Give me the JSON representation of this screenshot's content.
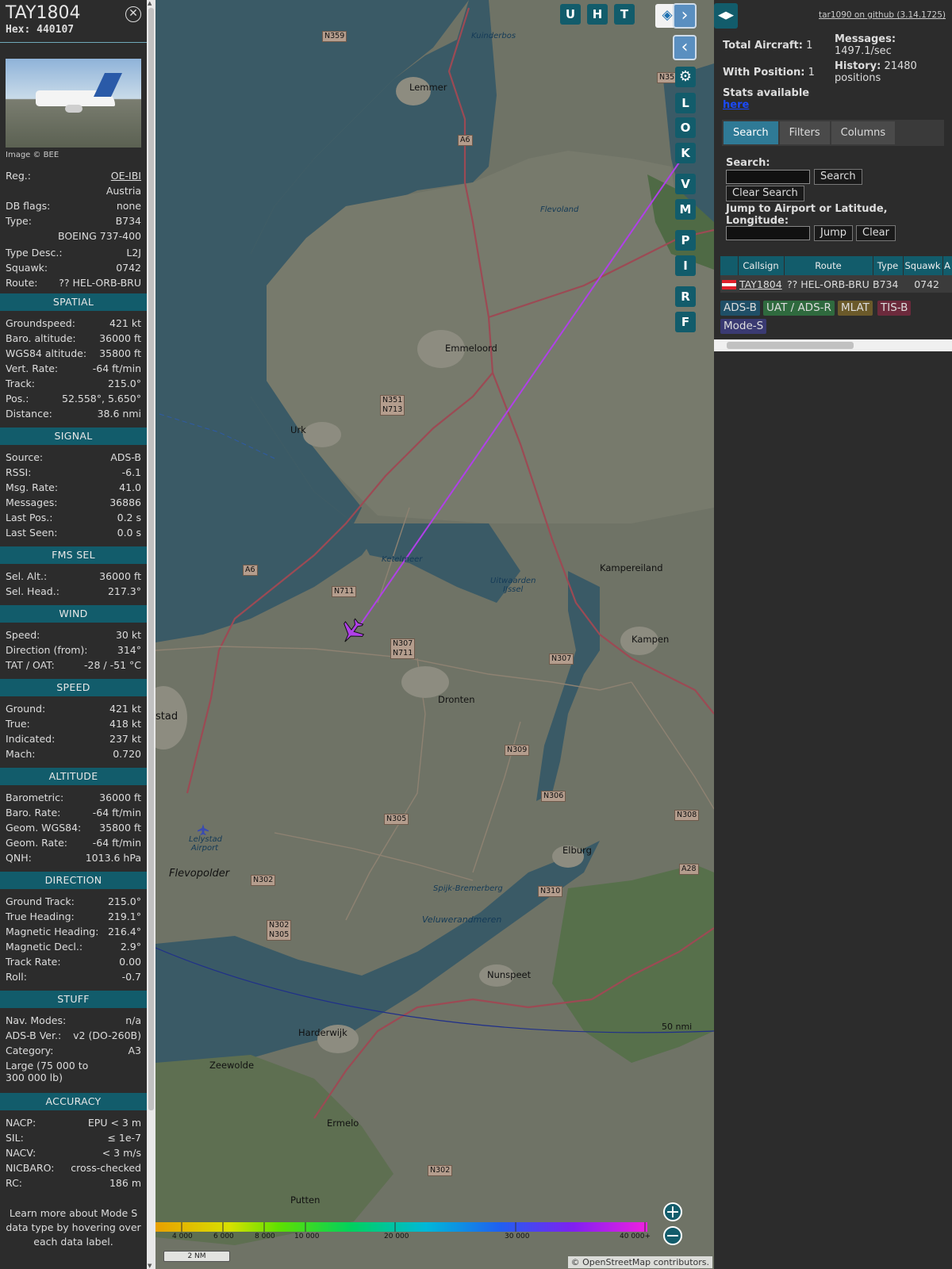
{
  "aircraft": {
    "callsign": "TAY1804",
    "hex_label": "Hex:",
    "hex": "440107",
    "image_credit": "Image © BEE",
    "reg_label": "Reg.:",
    "reg": "OE-IBI",
    "country": "Austria",
    "dbflags_label": "DB flags:",
    "dbflags": "none",
    "type_label": "Type:",
    "type": "B734",
    "type_full": "BOEING 737-400",
    "typedesc_label": "Type Desc.:",
    "typedesc": "L2J",
    "squawk_label": "Squawk:",
    "squawk": "0742",
    "route_label": "Route:",
    "route": "?? HEL-ORB-BRU"
  },
  "sections": {
    "spatial": {
      "title": "SPATIAL",
      "rows": [
        {
          "label": "Groundspeed:",
          "value": "421 kt"
        },
        {
          "label": "Baro. altitude:",
          "value": "36000 ft"
        },
        {
          "label": "WGS84 altitude:",
          "value": "35800 ft"
        },
        {
          "label": "Vert. Rate:",
          "value": "-64 ft/min"
        },
        {
          "label": "Track:",
          "value": "215.0°"
        },
        {
          "label": "Pos.:",
          "value": "52.558°, 5.650°"
        },
        {
          "label": "Distance:",
          "value": "38.6 nmi"
        }
      ]
    },
    "signal": {
      "title": "SIGNAL",
      "rows": [
        {
          "label": "Source:",
          "value": "ADS-B"
        },
        {
          "label": "RSSI:",
          "value": "-6.1"
        },
        {
          "label": "Msg. Rate:",
          "value": "41.0"
        },
        {
          "label": "Messages:",
          "value": "36886"
        },
        {
          "label": "Last Pos.:",
          "value": "0.2 s"
        },
        {
          "label": "Last Seen:",
          "value": "0.0 s"
        }
      ]
    },
    "fms": {
      "title": "FMS SEL",
      "rows": [
        {
          "label": "Sel. Alt.:",
          "value": "36000 ft"
        },
        {
          "label": "Sel. Head.:",
          "value": "217.3°"
        }
      ]
    },
    "wind": {
      "title": "WIND",
      "rows": [
        {
          "label": "Speed:",
          "value": "30 kt"
        },
        {
          "label": "Direction (from):",
          "value": "314°"
        },
        {
          "label": "TAT / OAT:",
          "value": "-28 / -51 °C"
        }
      ]
    },
    "speed": {
      "title": "SPEED",
      "rows": [
        {
          "label": "Ground:",
          "value": "421 kt"
        },
        {
          "label": "True:",
          "value": "418 kt"
        },
        {
          "label": "Indicated:",
          "value": "237 kt"
        },
        {
          "label": "Mach:",
          "value": "0.720"
        }
      ]
    },
    "altitude": {
      "title": "ALTITUDE",
      "rows": [
        {
          "label": "Barometric:",
          "value": "36000 ft"
        },
        {
          "label": "Baro. Rate:",
          "value": "-64 ft/min"
        },
        {
          "label": "Geom. WGS84:",
          "value": "35800 ft"
        },
        {
          "label": "Geom. Rate:",
          "value": "-64 ft/min"
        },
        {
          "label": "QNH:",
          "value": "1013.6 hPa"
        }
      ]
    },
    "direction": {
      "title": "DIRECTION",
      "rows": [
        {
          "label": "Ground Track:",
          "value": "215.0°"
        },
        {
          "label": "True Heading:",
          "value": "219.1°"
        },
        {
          "label": "Magnetic Heading:",
          "value": "216.4°"
        },
        {
          "label": "Magnetic Decl.:",
          "value": "2.9°"
        },
        {
          "label": "Track Rate:",
          "value": "0.00"
        },
        {
          "label": "Roll:",
          "value": "-0.7"
        }
      ]
    },
    "stuff": {
      "title": "STUFF",
      "rows": [
        {
          "label": "Nav. Modes:",
          "value": "n/a"
        },
        {
          "label": "ADS-B Ver.:",
          "value": "v2 (DO-260B)"
        },
        {
          "label": "Category:",
          "value": "A3"
        }
      ],
      "category_desc": "Large (75 000 to 300 000 lb)"
    },
    "accuracy": {
      "title": "ACCURACY",
      "rows": [
        {
          "label": "NACP:",
          "value": "EPU < 3 m"
        },
        {
          "label": "SIL:",
          "value": "≤ 1e-7"
        },
        {
          "label": "NACV:",
          "value": "< 3 m/s"
        },
        {
          "label": "NICBARO:",
          "value": "cross-checked"
        },
        {
          "label": "RC:",
          "value": "186 m"
        }
      ]
    },
    "learn_more": "Learn more about Mode S data type by hovering over each data label."
  },
  "map": {
    "buttons_top": [
      "U",
      "H",
      "T"
    ],
    "buttons_side": [
      "L",
      "O",
      "K",
      "V",
      "M",
      "P",
      "I",
      "R",
      "F"
    ],
    "places": [
      {
        "name": "Lemmer"
      },
      {
        "name": "Emmeloord"
      },
      {
        "name": "Urk"
      },
      {
        "name": "Dronten"
      },
      {
        "name": "Kampen"
      },
      {
        "name": "Kampereiland"
      },
      {
        "name": "Elburg"
      },
      {
        "name": "Nunspeet"
      },
      {
        "name": "Harderwijk"
      },
      {
        "name": "Zeewolde"
      },
      {
        "name": "Ermelo"
      },
      {
        "name": "Putten"
      },
      {
        "name": "Flevopolder"
      },
      {
        "name": "stad"
      },
      {
        "name": "Lelystad Airport"
      }
    ],
    "scale": "2 NM",
    "range_ring": "50 nmi",
    "attribution": "© OpenStreetMap contributors.",
    "altitude_legend": [
      "4 000",
      "6 000",
      "8 000",
      "10 000",
      "20 000",
      "30 000",
      "40 000+"
    ]
  },
  "right": {
    "github": "tar1090 on github (3.14.1725)",
    "total_label": "Total Aircraft:",
    "total": "1",
    "withpos_label": "With Position:",
    "withpos": "1",
    "stats_label": "Stats available",
    "stats_link": "here",
    "messages_label": "Messages:",
    "messages": "1497.1/sec",
    "history_label": "History:",
    "history": "21480 positions",
    "tabs": [
      "Search",
      "Filters",
      "Columns"
    ],
    "search_label": "Search:",
    "search_button": "Search",
    "clear_search_button": "Clear Search",
    "jump_label": "Jump to Airport or Latitude, Longitude:",
    "jump_button": "Jump",
    "clear_button": "Clear",
    "table": {
      "headers": [
        "",
        "Callsign",
        "Route",
        "Type",
        "Squawk",
        "A"
      ],
      "row": {
        "callsign": "TAY1804",
        "route": "?? HEL-ORB-BRU",
        "type": "B734",
        "squawk": "0742"
      }
    },
    "source_tags": [
      {
        "label": "ADS-B",
        "bg": "#1f4f67"
      },
      {
        "label": "UAT / ADS-R",
        "bg": "#2f6a3e"
      },
      {
        "label": "MLAT",
        "bg": "#6b5a2a"
      },
      {
        "label": "TIS-B",
        "bg": "#6c2a3c"
      },
      {
        "label": "Mode-S",
        "bg": "#3a3a72"
      }
    ]
  },
  "colors": {
    "accent": "#125c6b",
    "track": "#b040e8",
    "aircraft": "#b040e8"
  }
}
